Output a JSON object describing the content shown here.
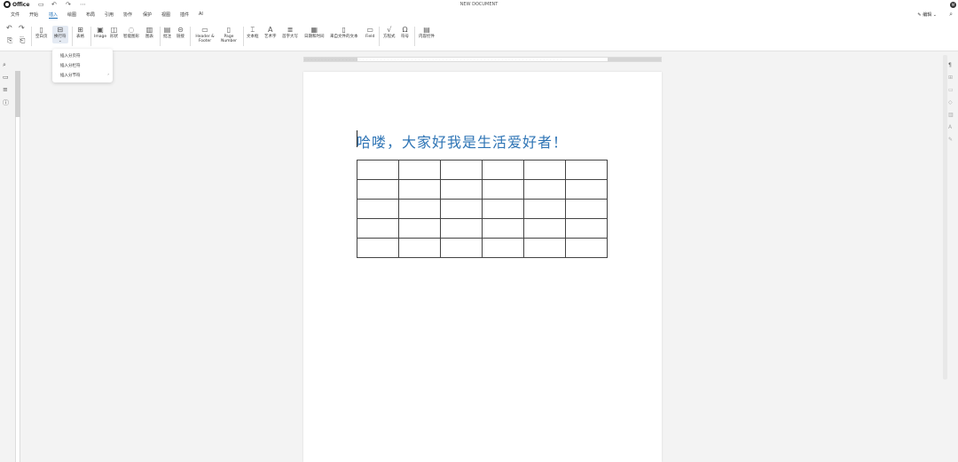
{
  "app": {
    "logo_text": "Office",
    "doc_title": "NEW DOCUMENT",
    "user_initial": "M"
  },
  "menus": [
    "文件",
    "开始",
    "插入",
    "绘图",
    "布局",
    "引用",
    "协作",
    "保护",
    "视图",
    "插件",
    "AI"
  ],
  "active_menu": "插入",
  "edit_mode": "编辑",
  "ribbon": {
    "undo_icon": "↶",
    "redo_icon": "↷",
    "blank_page": "空白页",
    "page_break": "换行符",
    "table": "表格",
    "image": "Image",
    "shapes": "形状",
    "smart_art": "智能图形",
    "chart": "图表",
    "comment": "批注",
    "link": "链接",
    "header_footer": "Header & Footer",
    "page_number": "Page Number",
    "text_box": "文本框",
    "art_text": "艺术字",
    "drop_cap": "首字大写",
    "date_time": "日期和时间",
    "from_file": "来自文件的文本",
    "field": "Field",
    "equation": "方程式",
    "symbol": "符号",
    "content_control": "内容控件"
  },
  "dropdown": {
    "items": [
      "插入分页符",
      "插入分栏符",
      "插入分节符"
    ],
    "submenu_arrow": "›"
  },
  "document": {
    "heading": "哈喽，大家好我是生活爱好者！",
    "table": {
      "rows": 5,
      "cols": 6
    }
  },
  "colors": {
    "accent": "#1d6fb8",
    "heading": "#2e74b5"
  }
}
